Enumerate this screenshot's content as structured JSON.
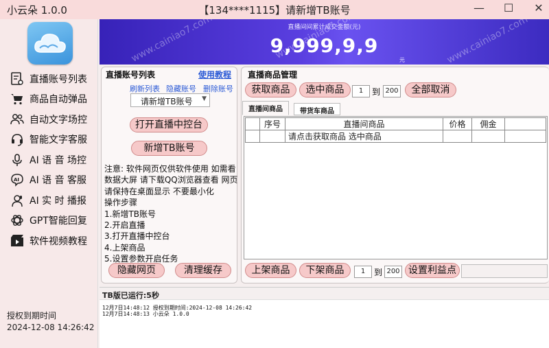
{
  "titlebar": {
    "app_title": "小云朵 1.0.0",
    "window_title": "【134****1115】请新增TB账号"
  },
  "sidebar": {
    "items": [
      {
        "label": "直播账号列表",
        "icon": "account-list-icon"
      },
      {
        "label": "商品自动弹品",
        "icon": "cart-icon"
      },
      {
        "label": "自动文字场控",
        "icon": "users-icon"
      },
      {
        "label": "智能文字客服",
        "icon": "headset-icon"
      },
      {
        "label": "AI 语 音 场控",
        "icon": "microphone-icon"
      },
      {
        "label": "AI 语 音 客服",
        "icon": "ai-voice-icon"
      },
      {
        "label": "AI 实 时 播报",
        "icon": "broadcaster-icon"
      },
      {
        "label": "GPT智能回复",
        "icon": "openai-icon"
      },
      {
        "label": "软件视频教程",
        "icon": "video-icon"
      }
    ],
    "expire_label": "授权到期时间",
    "expire_time": "2024-12-08 14:26:42"
  },
  "banner": {
    "caption": "直播间间累计成交金额(元)",
    "amount": "9,999,9,9",
    "unit": "元",
    "watermark": "www.cainiao7.com"
  },
  "account_panel": {
    "title": "直播账号列表",
    "tutorial_link": "使用教程",
    "refresh_link": "刷新列表",
    "hide_link": "隐藏账号",
    "delete_link": "删除账号",
    "account_select": "请新增TB账号",
    "open_console_btn": "打开直播中控台",
    "add_account_btn": "新增TB账号",
    "note": "注意: 软件网页仅供软件使用 如需看数据大屏 请下载QQ浏览器查看 网页请保持在桌面显示 不要最小化",
    "steps_title": "操作步骤",
    "steps": [
      "1.新增TB账号",
      "2.开启直播",
      "3.打开直播中控台",
      "4.上架商品",
      "5.设置参数开启任务"
    ],
    "hide_web_btn": "隐藏网页",
    "clear_cache_btn": "清理缓存"
  },
  "goods_panel": {
    "title": "直播商品管理",
    "fetch_btn": "获取商品",
    "select_btn": "选中商品",
    "range_from": "1",
    "range_to_label": "到",
    "range_to": "200",
    "cancel_all_btn": "全部取消",
    "tabs": [
      "直播间商品",
      "带货车商品"
    ],
    "columns": [
      "",
      "序号",
      "直播间商品",
      "价格",
      "佣金",
      ""
    ],
    "rows": [
      [
        "",
        "",
        "请点击获取商品 选中商品",
        "",
        "",
        ""
      ]
    ],
    "list_btn": "上架商品",
    "delist_btn": "下架商品",
    "bottom_from": "1",
    "bottom_to_label": "到",
    "bottom_to": "200",
    "profit_btn": "设置利益点"
  },
  "log": {
    "header": "TB版已运行:5秒",
    "lines": [
      "12月7日14:48:12 授权到期时间:2024-12-08 14:26:42",
      "12月7日14:48:13 小云朵 1.0.0"
    ]
  }
}
